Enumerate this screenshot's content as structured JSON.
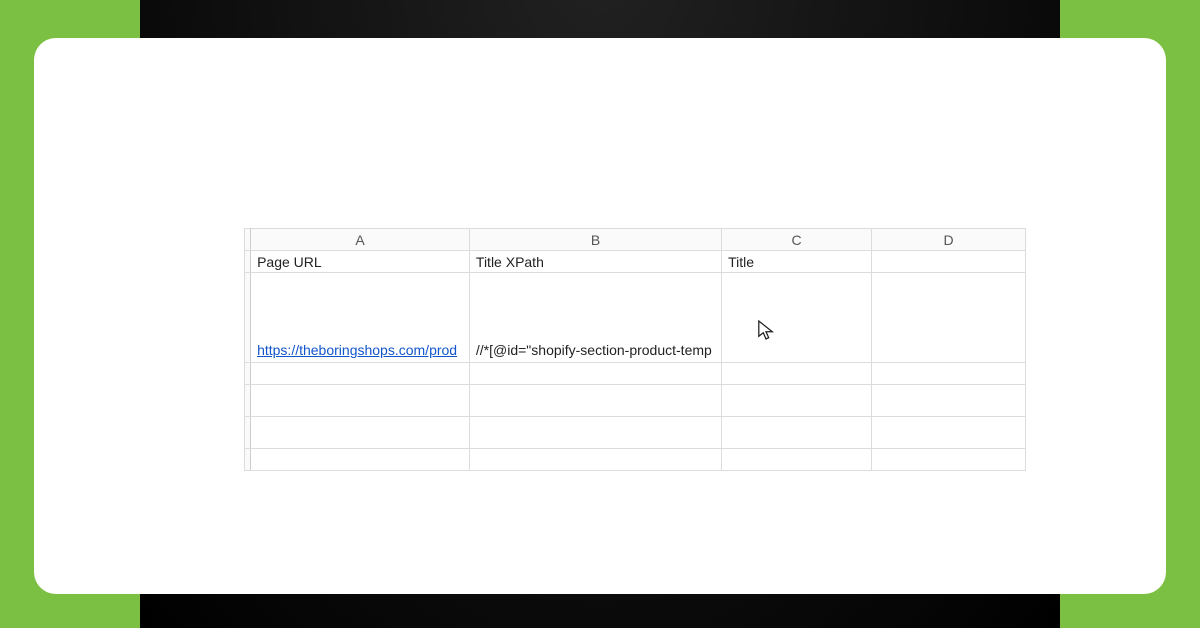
{
  "columns": {
    "a": "A",
    "b": "B",
    "c": "C",
    "d": "D"
  },
  "headers": {
    "a": "Page URL",
    "b": "Title XPath",
    "c": "Title",
    "d": ""
  },
  "row2": {
    "a": "https://theboringshops.com/prod",
    "b": "//*[@id=\"shopify-section-product-temp",
    "c": "",
    "d": ""
  },
  "icons": {
    "cursor": "cursor-icon"
  }
}
